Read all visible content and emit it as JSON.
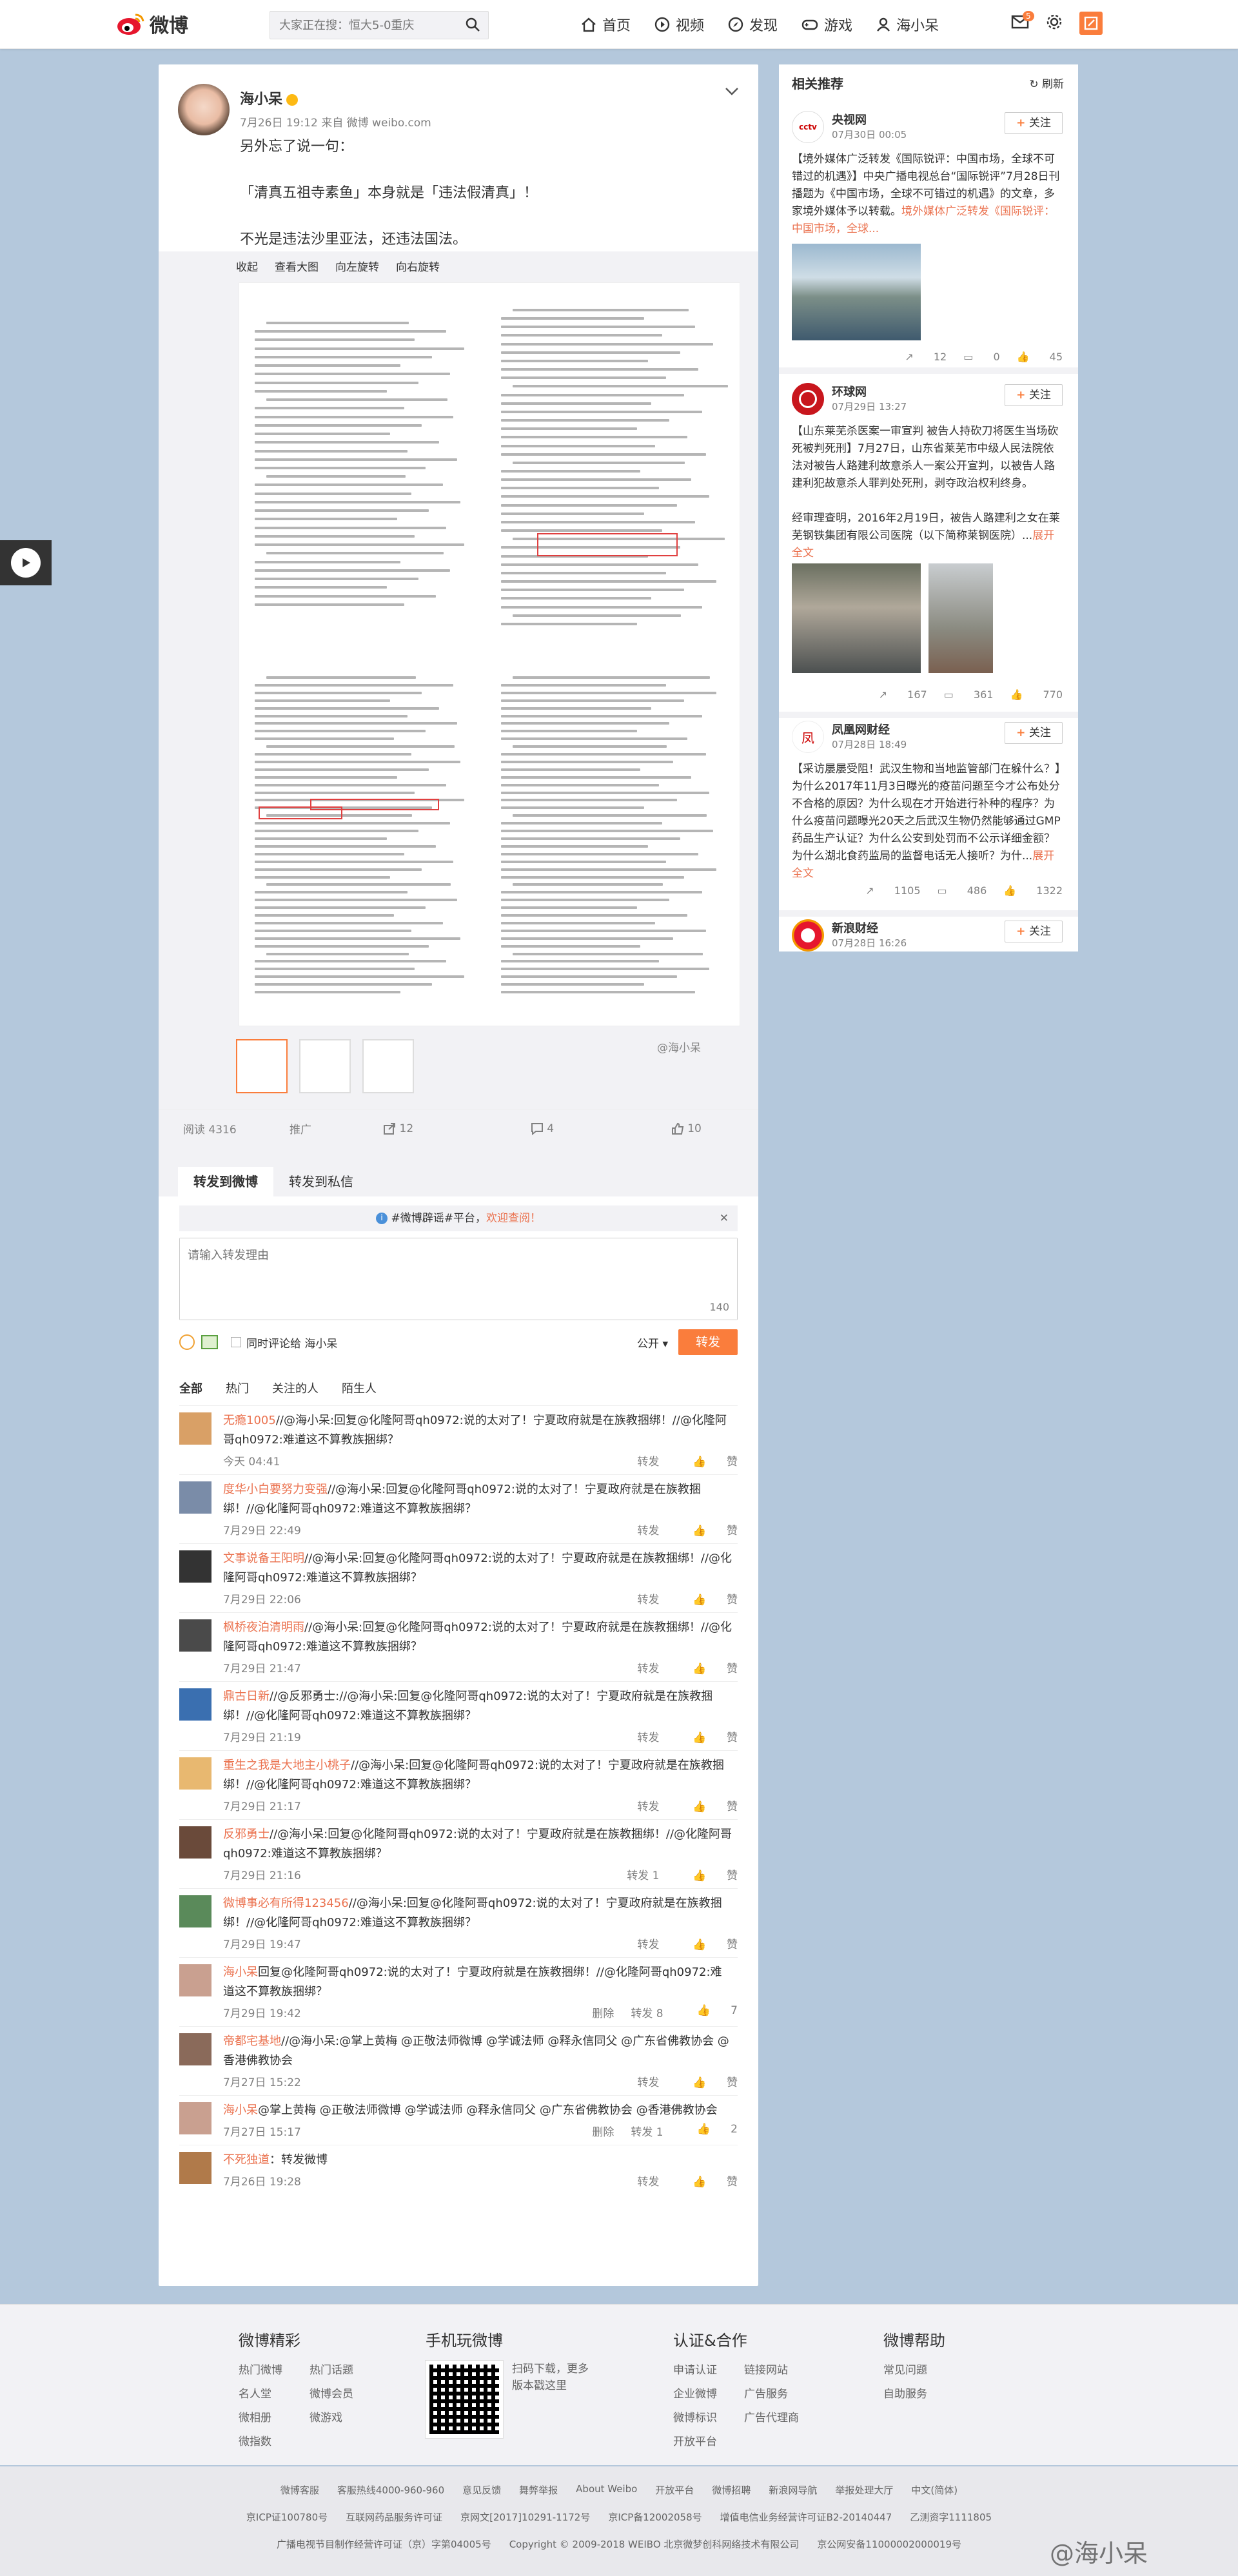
{
  "topbar": {
    "logo": "微博",
    "search_placeholder": "大家正在搜：恒大5-0重庆",
    "nav": [
      "首页",
      "视频",
      "发现",
      "游戏",
      "海小呆"
    ],
    "mail_badge": "5"
  },
  "post": {
    "author": "海小呆",
    "meta": "7月26日 19:12 来自 微博 weibo.com",
    "lines": [
      "另外忘了说一句：",
      "「清真五祖寺素鱼」本身就是「违法假清真」！",
      "不光是违法沙里亚法，还违法国法。"
    ],
    "media_tools": [
      "收起",
      "查看大图",
      "向左旋转",
      "向右旋转"
    ],
    "watermark": "@海小呆",
    "stats": {
      "reads": "阅读 4316",
      "promote": "推广",
      "repost": "12",
      "comment": "4",
      "like": "10"
    }
  },
  "reply": {
    "tabs": [
      "转发到微博",
      "转发到私信"
    ],
    "tip_prefix": "#微博辟谣#平台，",
    "tip_link": "欢迎查阅！",
    "placeholder": "请输入转发理由",
    "count": "140",
    "also_comment": "同时评论给 海小呆",
    "visibility": "公开",
    "submit": "转发"
  },
  "filters": [
    "全部",
    "热门",
    "关注的人",
    "陌生人"
  ],
  "comments": [
    {
      "user": "无瘾1005",
      "text": "//@海小呆:回复@化隆阿哥qh0972:说的太对了！宁夏政府就是在族教捆绑！//@化隆阿哥qh0972:难道这不算教族捆绑？",
      "time": "今天 04:41",
      "repost": "转发",
      "like": "赞",
      "color": "#d9a066"
    },
    {
      "user": "度华小白要努力变强",
      "text": "//@海小呆:回复@化隆阿哥qh0972:说的太对了！宁夏政府就是在族教捆绑！//@化隆阿哥qh0972:难道这不算教族捆绑？",
      "time": "7月29日 22:49",
      "repost": "转发",
      "like": "赞",
      "color": "#7a8ca8"
    },
    {
      "user": "文事说备王阳明",
      "text": "//@海小呆:回复@化隆阿哥qh0972:说的太对了！宁夏政府就是在族教捆绑！//@化隆阿哥qh0972:难道这不算教族捆绑？",
      "time": "7月29日 22:06",
      "repost": "转发",
      "like": "赞",
      "color": "#333333"
    },
    {
      "user": "枫桥夜泊清明雨",
      "text": "//@海小呆:回复@化隆阿哥qh0972:说的太对了！宁夏政府就是在族教捆绑！//@化隆阿哥qh0972:难道这不算教族捆绑？",
      "time": "7月29日 21:47",
      "repost": "转发",
      "like": "赞",
      "color": "#4a4a4a"
    },
    {
      "user": "鼎古日新",
      "text": "//@反邪勇士://@海小呆:回复@化隆阿哥qh0972:说的太对了！宁夏政府就是在族教捆绑！//@化隆阿哥qh0972:难道这不算教族捆绑？",
      "time": "7月29日 21:19",
      "repost": "转发",
      "like": "赞",
      "color": "#3a6fb0"
    },
    {
      "user": "重生之我是大地主小桃子",
      "text": "//@海小呆:回复@化隆阿哥qh0972:说的太对了！宁夏政府就是在族教捆绑！//@化隆阿哥qh0972:难道这不算教族捆绑？",
      "time": "7月29日 21:17",
      "repost": "转发",
      "like": "赞",
      "color": "#e8b870"
    },
    {
      "user": "反邪勇士",
      "text": "//@海小呆:回复@化隆阿哥qh0972:说的太对了！宁夏政府就是在族教捆绑！//@化隆阿哥qh0972:难道这不算教族捆绑？",
      "time": "7月29日 21:16",
      "repost": "转发 1",
      "like": "赞",
      "color": "#6a4a3a"
    },
    {
      "user": "微博事必有所得123456",
      "text": "//@海小呆:回复@化隆阿哥qh0972:说的太对了！宁夏政府就是在族教捆绑！//@化隆阿哥qh0972:难道这不算教族捆绑？",
      "time": "7月29日 19:47",
      "repost": "转发",
      "like": "赞",
      "color": "#5a8a5a"
    },
    {
      "user": "海小呆",
      "text": "回复@化隆阿哥qh0972:说的太对了！宁夏政府就是在族教捆绑！//@化隆阿哥qh0972:难道这不算教族捆绑？",
      "time": "7月29日 19:42",
      "delete": "删除",
      "repost": "转发 8",
      "like": "7",
      "color": "#c9a090"
    },
    {
      "user": "帝都宅基地",
      "text": "//@海小呆:@掌上黄梅 @正敬法师微博 @学诚法师 @释永信同父 @广东省佛教协会 @香港佛教协会",
      "time": "7月27日 15:22",
      "repost": "转发",
      "like": "赞",
      "color": "#8a6a5a"
    },
    {
      "user": "海小呆",
      "text": "@掌上黄梅 @正敬法师微博 @学诚法师 @释永信同父 @广东省佛教协会 @香港佛教协会",
      "time": "7月27日 15:17",
      "delete": "删除",
      "repost": "转发 1",
      "like": "2",
      "color": "#c9a090"
    },
    {
      "user": "不死独道",
      "text": "：转发微博",
      "time": "7月26日 19:28",
      "repost": "转发",
      "like": "赞",
      "color": "#b07a4a"
    }
  ],
  "side": {
    "title": "相关推荐",
    "refresh": "刷新",
    "follow": "关注",
    "cards": [
      {
        "name": "央视网",
        "time": "07月30日 00:05",
        "text": "【境外媒体广泛转发《国际锐评：中国市场，全球不可错过的机遇》】中央广播电视总台“国际锐评”7月28日刊播题为《中国市场，全球不可错过的机遇》的文章，多家境外媒体予以转载。",
        "link": "境外媒体广泛转发《国际锐评：中国市场，全球...",
        "repost": "12",
        "comment": "0",
        "like": "45"
      },
      {
        "name": "环球网",
        "time": "07月29日 13:27",
        "text": "【山东莱芜杀医案一审宣判 被告人持砍刀将医生当场砍死被判死刑】7月27日，山东省莱芜市中级人民法院依法对被告人路建利故意杀人一案公开宣判，以被告人路建利犯故意杀人罪判处死刑，剥夺政治权利终身。",
        "text2": "经审理查明，2016年2月19日，被告人路建利之女在莱芜钢铁集团有限公司医院（以下简称莱钢医院）...",
        "more": "展开全文",
        "repost": "167",
        "comment": "361",
        "like": "770"
      },
      {
        "name": "凤凰网财经",
        "time": "07月28日 18:49",
        "text": "【采访屡屡受阻！武汉生物和当地监管部门在躲什么？】为什么2017年11月3日曝光的疫苗问题至今才公布处分不合格的原因？为什么现在才开始进行补种的程序？为什么疫苗问题曝光20天之后武汉生物仍然能够通过GMP药品生产认证？为什么公安到处罚而不公示详细金额？为什么湖北食药监局的监督电话无人接听？为什...",
        "more": "展开全文",
        "repost": "1105",
        "comment": "486",
        "like": "1322"
      },
      {
        "name": "新浪财经",
        "time": "07月28日 16:26"
      }
    ]
  },
  "footer": {
    "cols": [
      {
        "title": "微博精彩",
        "items": [
          "热门微博",
          "热门话题",
          "名人堂",
          "微博会员",
          "微相册",
          "微游戏",
          "微指数"
        ]
      },
      {
        "title": "手机玩微博",
        "desc": "扫码下载，更多版本戳这里"
      },
      {
        "title": "认证&合作",
        "items": [
          "申请认证",
          "链接网站",
          "企业微博",
          "广告服务",
          "微博标识",
          "广告代理商",
          "开放平台"
        ]
      },
      {
        "title": "微博帮助",
        "items": [
          "常见问题",
          "自助服务"
        ]
      }
    ],
    "row1": [
      "微博客服",
      "客服热线4000-960-960",
      "意见反馈",
      "舞弊举报",
      "About Weibo",
      "开放平台",
      "微博招聘",
      "新浪网导航",
      "举报处理大厅",
      "中文(简体)"
    ],
    "row2": [
      "京ICP证100780号",
      "互联网药品服务许可证",
      "京网文[2017]10291-1172号",
      "京ICP备12002058号",
      "增值电信业务经营许可证B2-20140447",
      "乙测资字1111805"
    ],
    "row3": [
      "广播电视节目制作经营许可证（京）字第04005号",
      "Copyright © 2009-2018 WEIBO 北京微梦创科网络技术有限公司",
      "京公网安备11000002000019号"
    ],
    "brand_watermark": "@海小呆"
  },
  "colors": {
    "accent": "#fa7d3c",
    "link": "#eb7350",
    "bg": "#b4c8dc"
  }
}
